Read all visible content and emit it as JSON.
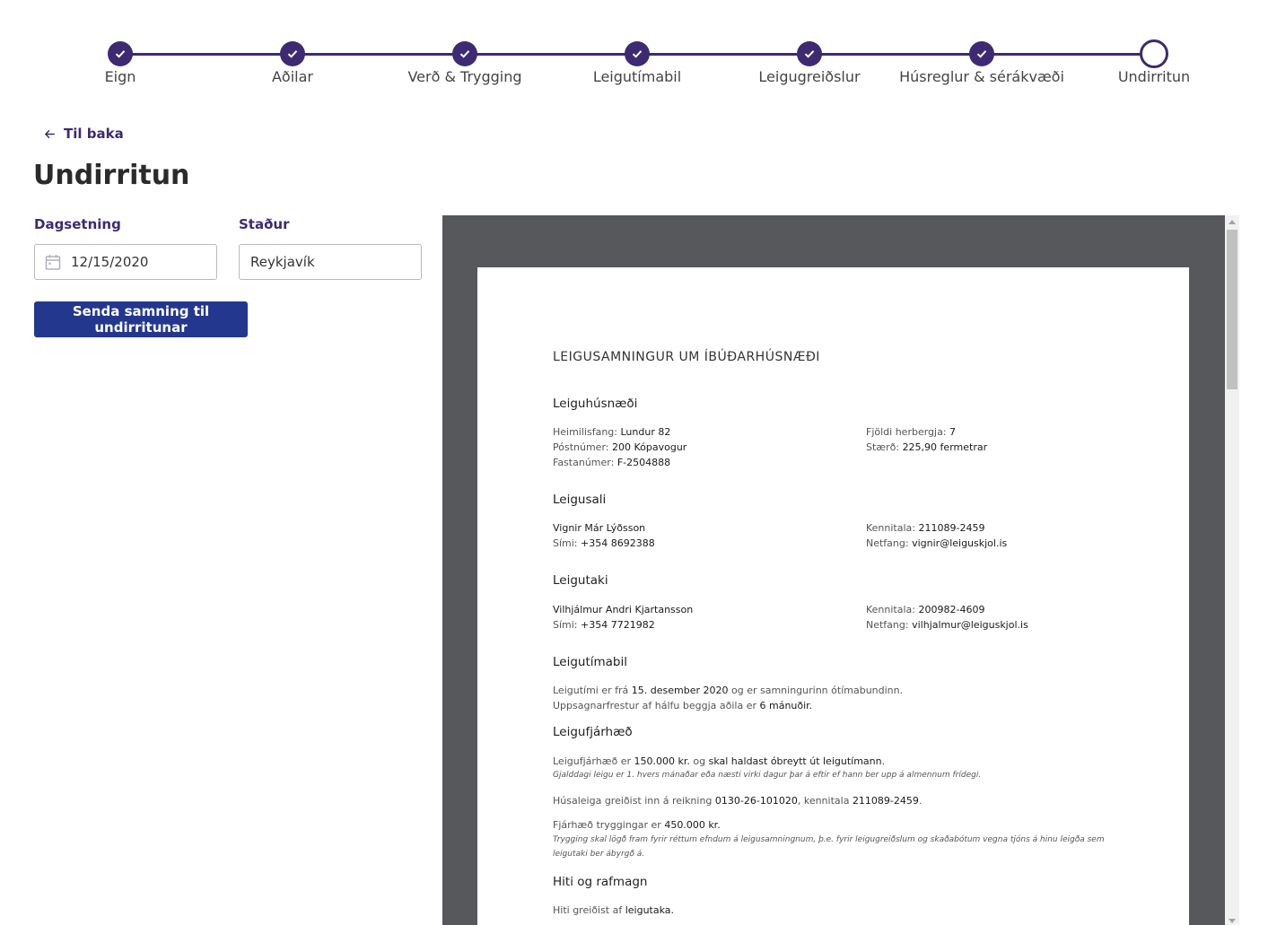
{
  "stepper": {
    "steps": [
      {
        "label": "Eign",
        "status": "done"
      },
      {
        "label": "Aðilar",
        "status": "done"
      },
      {
        "label": "Verð & Trygging",
        "status": "done"
      },
      {
        "label": "Leigutímabil",
        "status": "done"
      },
      {
        "label": "Leigugreiðslur",
        "status": "done"
      },
      {
        "label": "Húsreglur & sérákvæði",
        "status": "done"
      },
      {
        "label": "Undirritun",
        "status": "current"
      }
    ],
    "accent_color": "#3d2a73"
  },
  "back_label": "Til baka",
  "page_title": "Undirritun",
  "form": {
    "date_label": "Dagsetning",
    "date_value": "12/15/2020",
    "place_label": "Staður",
    "place_value": "Reykjavík",
    "submit_label": "Senda samning til undirritunar",
    "submit_color": "#24378f"
  },
  "document": {
    "title": "LEIGUSAMNINGUR UM ÍBÚÐARHÚSNÆÐI",
    "property": {
      "heading": "Leiguhúsnæði",
      "address_label": "Heimilisfang:",
      "address": "Lundur 82",
      "postal_label": "Póstnúmer:",
      "postal": "200 Kópavogur",
      "fastanumer_label": "Fastanúmer:",
      "fastanumer": "F-2504888",
      "rooms_label": "Fjöldi herbergja:",
      "rooms": "7",
      "size_label": "Stærð:",
      "size": "225,90 fermetrar"
    },
    "landlord": {
      "heading": "Leigusali",
      "name": "Vignir Már Lýðsson",
      "phone_label": "Sími:",
      "phone": "+354 8692388",
      "kt_label": "Kennitala:",
      "kt": "211089-2459",
      "email_label": "Netfang:",
      "email": "vignir@leiguskjol.is"
    },
    "tenant": {
      "heading": "Leigutaki",
      "name": "Vilhjálmur Andri Kjartansson",
      "phone_label": "Sími:",
      "phone": "+354 7721982",
      "kt_label": "Kennitala:",
      "kt": "200982-4609",
      "email_label": "Netfang:",
      "email": "vilhjalmur@leiguskjol.is"
    },
    "period": {
      "heading": "Leigutímabil",
      "l1a": "Leigutími er frá ",
      "l1b": "15. desember 2020",
      "l1c": " og er samningurinn ótímabundinn.",
      "l2a": "Uppsagnarfrestur af hálfu beggja aðila er ",
      "l2b": "6 mánuðir."
    },
    "amount": {
      "heading": "Leigufjárhæð",
      "l1a": "Leigufjárhæð er ",
      "l1b": "150.000 kr.",
      "l1c": " og ",
      "l1d": "skal haldast óbreytt út leigutímann",
      "l1e": ".",
      "note1": "Gjalddagi leigu er 1. hvers mánaðar eða næsti virki dagur þar á eftir ef hann ber upp á almennum frídegi.",
      "l2a": "Húsaleiga greiðist inn á reikning ",
      "l2b": "0130-26-101020",
      "l2c": ", kennitala ",
      "l2d": "211089-2459",
      "l2e": ".",
      "l3a": "Fjárhæð tryggingar er ",
      "l3b": "450.000 kr.",
      "note2a": "Trygging skal lögð fram fyrir réttum efndum á leigusamningnum, þ.e. fyrir leigugreiðslum og skaðabótum vegna tjóns á hinu leigða sem",
      "note2b": "leigutaki ber ábyrgð á."
    },
    "utilities": {
      "heading": "Hiti og rafmagn",
      "l1a": "Hiti greiðist af ",
      "l1b": "leigutaka."
    }
  }
}
